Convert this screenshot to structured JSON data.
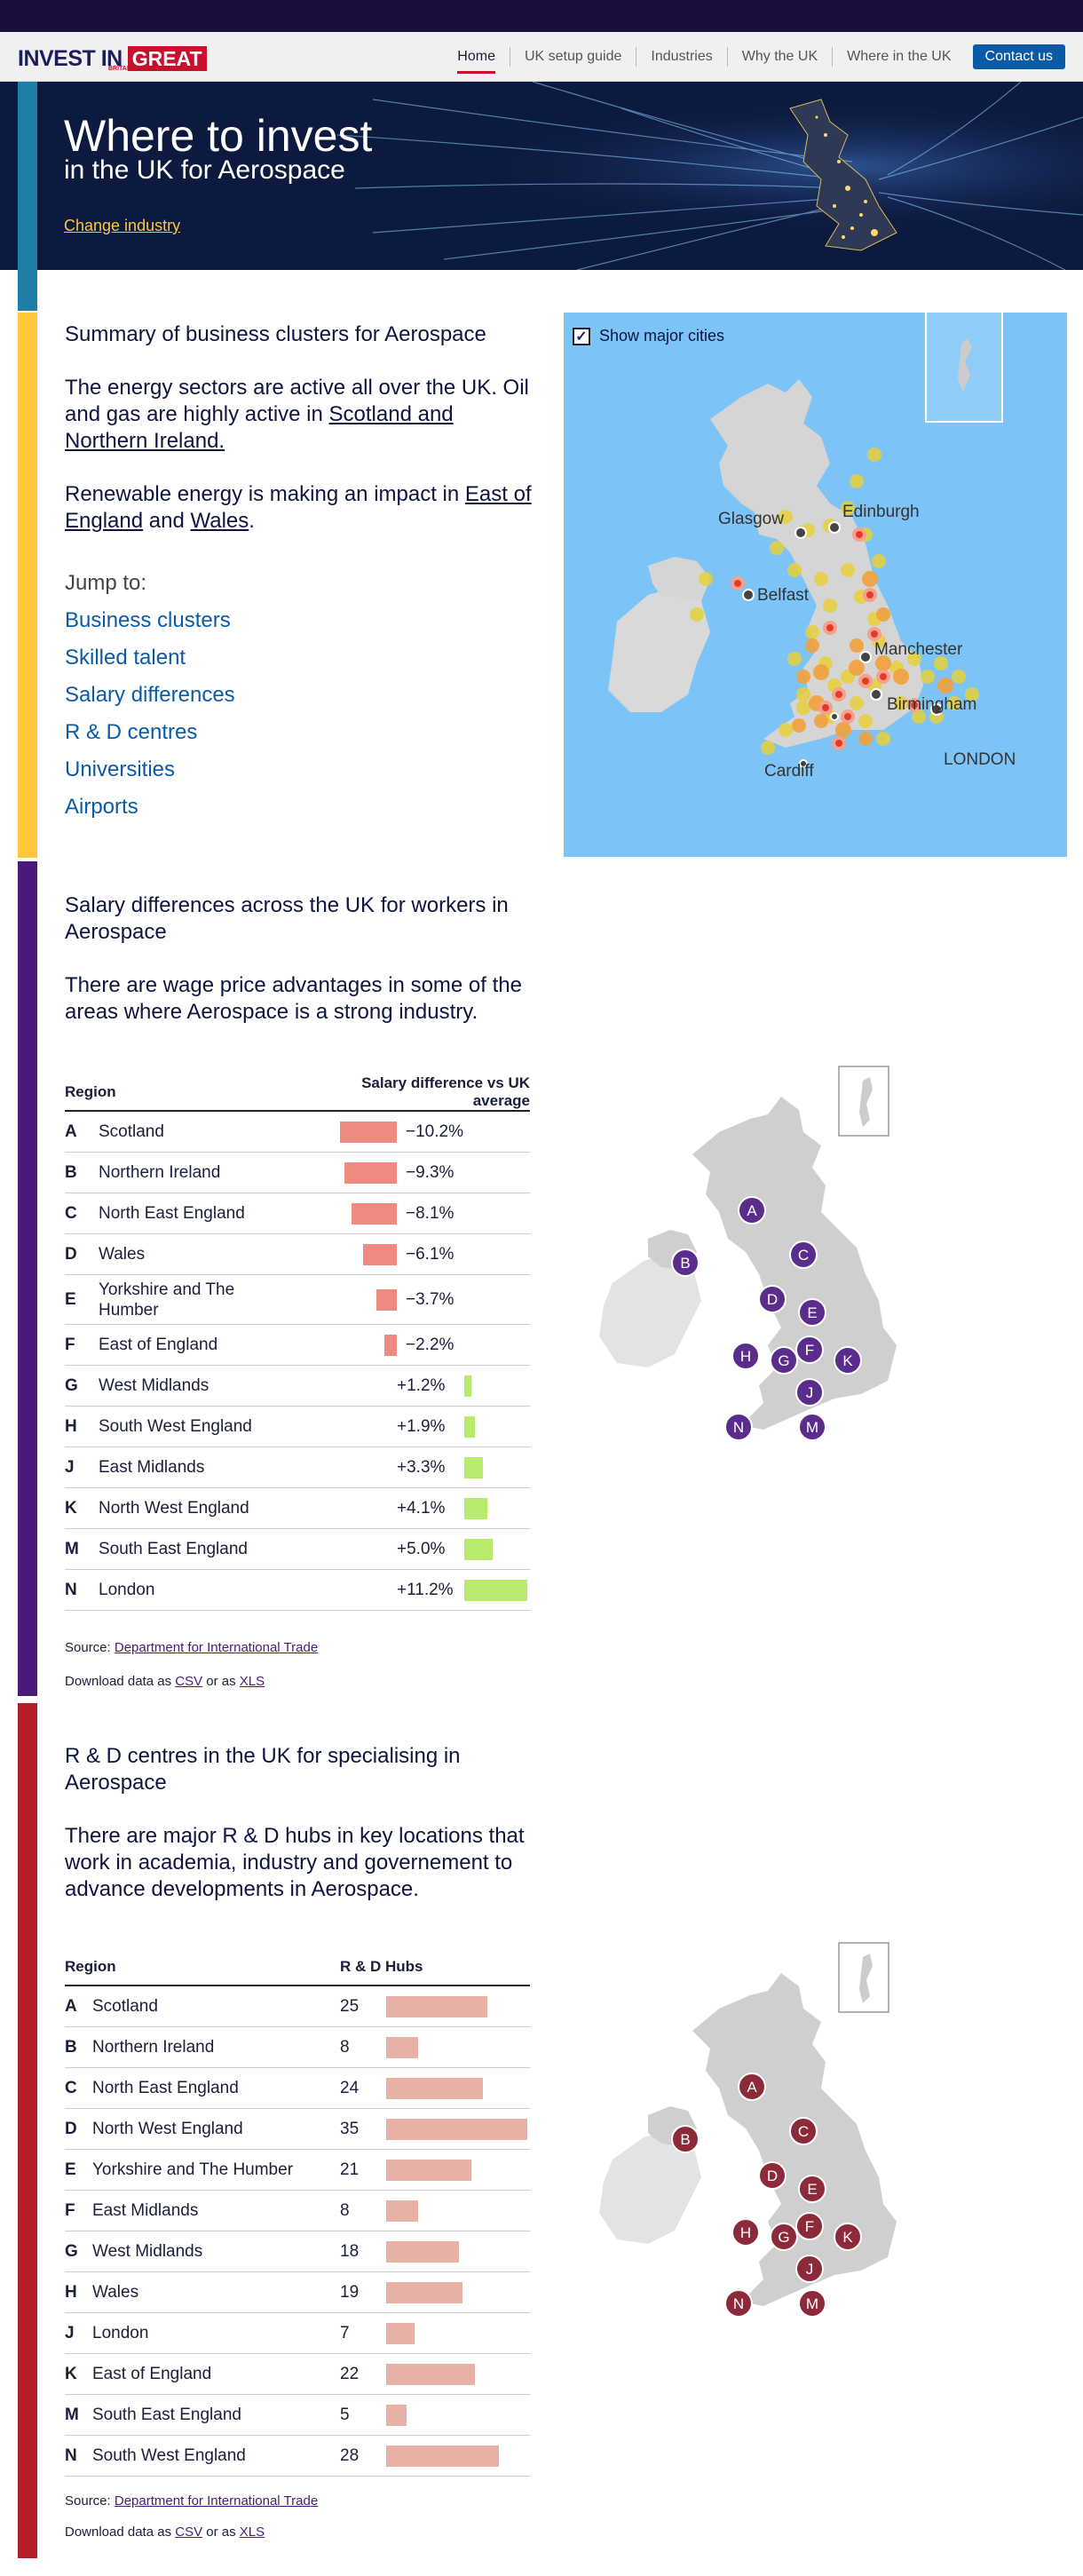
{
  "nav": {
    "logo_text": "INVEST IN",
    "logo_great": "GREAT",
    "logo_sub": "BRITAIN & NORTHERN IRELAND",
    "links": [
      "Home",
      "UK setup guide",
      "Industries",
      "Why the UK",
      "Where in the UK"
    ],
    "contact": "Contact us"
  },
  "hero": {
    "title": "Where to invest",
    "subtitle": "in the UK for Aerospace",
    "change_link": "Change industry"
  },
  "summary": {
    "title": "Summary of business clusters for Aerospace",
    "p1_a": "The energy sectors are active all over the UK. Oil and gas are highly active in ",
    "p1_scotland": "Scotland ",
    "p1_and": "and",
    "p1_ni": "Northern Ireland.",
    "p2_a": "Renewable energy is making an impact in ",
    "p2_east": "East of England",
    "p2_and": " and ",
    "p2_wales": "Wales",
    "p2_end": ".",
    "jump_label": "Jump to:",
    "jump_links": [
      "Business clusters",
      "Skilled talent",
      "Salary differences",
      "R & D centres",
      "Universities",
      "Airports"
    ],
    "map_checkbox": "Show major cities",
    "cities": [
      "Glasgow",
      "Edinburgh",
      "Belfast",
      "Manchester",
      "Birmingham",
      "Cardiff",
      "LONDON"
    ]
  },
  "salary": {
    "title": "Salary differences across the UK for workers in Aerospace",
    "body": "There are wage price advantages in some of the areas where Aerospace is a strong industry.",
    "col_region": "Region",
    "col_value": "Salary difference vs UK average",
    "rows": [
      {
        "code": "A",
        "region": "Scotland",
        "value": -10.2,
        "label": "−10.2%"
      },
      {
        "code": "B",
        "region": "Northern Ireland",
        "value": -9.3,
        "label": "−9.3%"
      },
      {
        "code": "C",
        "region": "North East England",
        "value": -8.1,
        "label": "−8.1%"
      },
      {
        "code": "D",
        "region": "Wales",
        "value": -6.1,
        "label": "−6.1%"
      },
      {
        "code": "E",
        "region": "Yorkshire and The Humber",
        "value": -3.7,
        "label": "−3.7%"
      },
      {
        "code": "F",
        "region": "East of England",
        "value": -2.2,
        "label": "−2.2%"
      },
      {
        "code": "G",
        "region": "West Midlands",
        "value": 1.2,
        "label": "+1.2%"
      },
      {
        "code": "H",
        "region": "South West England",
        "value": 1.9,
        "label": "+1.9%"
      },
      {
        "code": "J",
        "region": "East Midlands",
        "value": 3.3,
        "label": "+3.3%"
      },
      {
        "code": "K",
        "region": "North West England",
        "value": 4.1,
        "label": "+4.1%"
      },
      {
        "code": "M",
        "region": "South East England",
        "value": 5.0,
        "label": "+5.0%"
      },
      {
        "code": "N",
        "region": "London",
        "value": 11.2,
        "label": "+11.2%"
      }
    ],
    "source_label": "Source: ",
    "source_link": "Department for International Trade",
    "download_a": "Download data as ",
    "csv": "CSV",
    "download_or": " or as ",
    "xls": "XLS",
    "map_codes": [
      "A",
      "B",
      "C",
      "D",
      "E",
      "F",
      "G",
      "H",
      "J",
      "K",
      "M",
      "N"
    ],
    "pin_color": "#5a2d8c",
    "neg_color": "#ee8a7f",
    "pos_color": "#b8ea6e"
  },
  "rd": {
    "title": "R & D centres in the UK for specialising in Aerospace",
    "body": "There are major R & D hubs in key locations that work in academia, industry and governement to advance developments in Aerospace.",
    "col_region": "Region",
    "col_value": "R & D Hubs",
    "rows": [
      {
        "code": "A",
        "region": "Scotland",
        "value": 25
      },
      {
        "code": "B",
        "region": "Northern Ireland",
        "value": 8
      },
      {
        "code": "C",
        "region": "North East England",
        "value": 24
      },
      {
        "code": "D",
        "region": "North West England",
        "value": 35
      },
      {
        "code": "E",
        "region": "Yorkshire and The Humber",
        "value": 21
      },
      {
        "code": "F",
        "region": "East Midlands",
        "value": 8
      },
      {
        "code": "G",
        "region": "West Midlands",
        "value": 18
      },
      {
        "code": "H",
        "region": "Wales",
        "value": 19
      },
      {
        "code": "J",
        "region": "London",
        "value": 7
      },
      {
        "code": "K",
        "region": "East of England",
        "value": 22
      },
      {
        "code": "M",
        "region": "South East England",
        "value": 5
      },
      {
        "code": "N",
        "region": "South West England",
        "value": 28
      }
    ],
    "source_label": "Source: ",
    "source_link": "Department for International Trade",
    "download_a": "Download data as ",
    "csv": "CSV",
    "download_or": " or as ",
    "xls": "XLS",
    "pin_color": "#8c2a3a",
    "bar_color": "#e6b0a4"
  }
}
